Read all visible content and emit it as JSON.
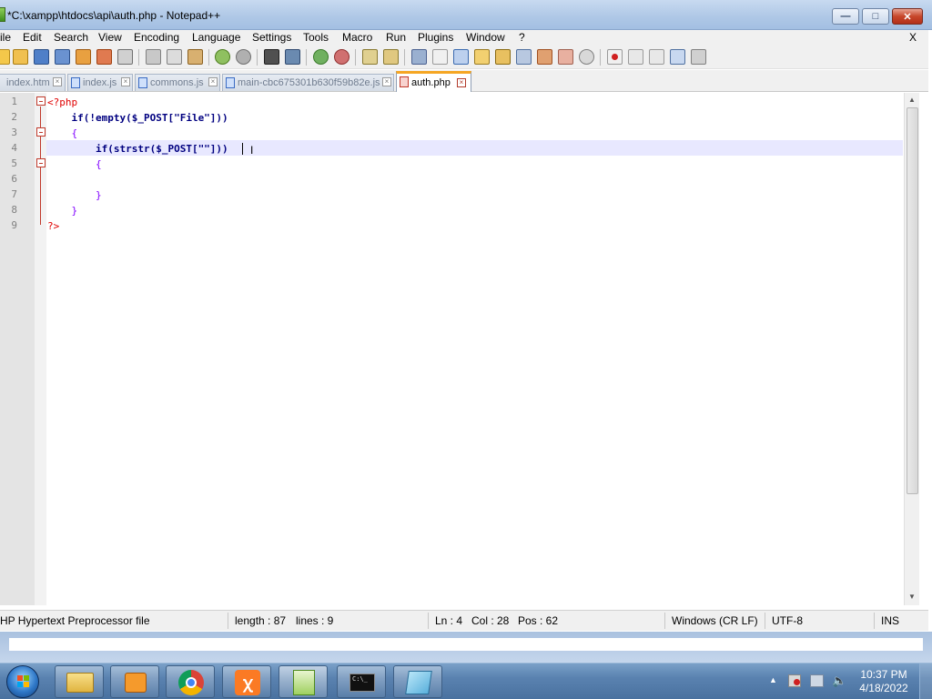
{
  "window": {
    "title": "*C:\\xampp\\htdocs\\api\\auth.php - Notepad++",
    "min_glyph": "—",
    "max_glyph": "□",
    "close_glyph": "✕"
  },
  "menu": {
    "items": [
      "ile",
      "Edit",
      "Search",
      "View",
      "Encoding",
      "Language",
      "Settings",
      "Tools",
      "Macro",
      "Run",
      "Plugins",
      "Window",
      "?"
    ],
    "close": "X"
  },
  "toolbar": {
    "buttons": [
      "new-file",
      "open-file",
      "save",
      "save-all",
      "close",
      "close-all",
      "print",
      "cut",
      "copy",
      "paste",
      "undo",
      "redo",
      "find",
      "replace",
      "zoom-in",
      "zoom-out",
      "sync-vertical",
      "sync-horizontal",
      "word-wrap",
      "show-all-characters",
      "indent-guide",
      "user-language",
      "document-map",
      "function-list",
      "folder-as-workspace",
      "monitoring",
      "record-macro",
      "stop-recording",
      "play-macro",
      "run-macro-multiple",
      "save-macro"
    ]
  },
  "tabs": [
    {
      "label": "index.htm",
      "active": false
    },
    {
      "label": "index.js",
      "active": false
    },
    {
      "label": "commons.js",
      "active": false
    },
    {
      "label": "main-cbc675301b630f59b82e.js",
      "active": false
    },
    {
      "label": "auth.php",
      "active": true
    }
  ],
  "editor": {
    "line_numbers": [
      "1",
      "2",
      "3",
      "4",
      "5",
      "6",
      "7",
      "8",
      "9"
    ],
    "lines": [
      "<?php",
      "    if(!empty($_POST[\"File\"]))",
      "    {",
      "        if(strstr($_POST[\"\"]))",
      "        {",
      "",
      "        }",
      "    }",
      "?>"
    ],
    "current_line": 4
  },
  "status": {
    "file_type": "HP Hypertext Preprocessor file",
    "length": "length : 87",
    "lines": "lines : 9",
    "ln": "Ln : 4",
    "col": "Col : 28",
    "pos": "Pos : 62",
    "eol": "Windows (CR LF)",
    "encoding": "UTF-8",
    "mode": "INS"
  },
  "taskbar": {
    "apps": [
      "windows-explorer",
      "media-player",
      "chrome",
      "xampp",
      "notepad-plus-plus",
      "command-prompt",
      "notepad"
    ],
    "clock_time": "10:37 PM",
    "clock_date": "4/18/2022"
  },
  "colors": {
    "keyword": "#000080",
    "php_tag": "#e00000",
    "string": "#808080",
    "operator": "#8000ff",
    "current_line": "#e8e8ff",
    "active_tab_accent": "#f5a623"
  }
}
